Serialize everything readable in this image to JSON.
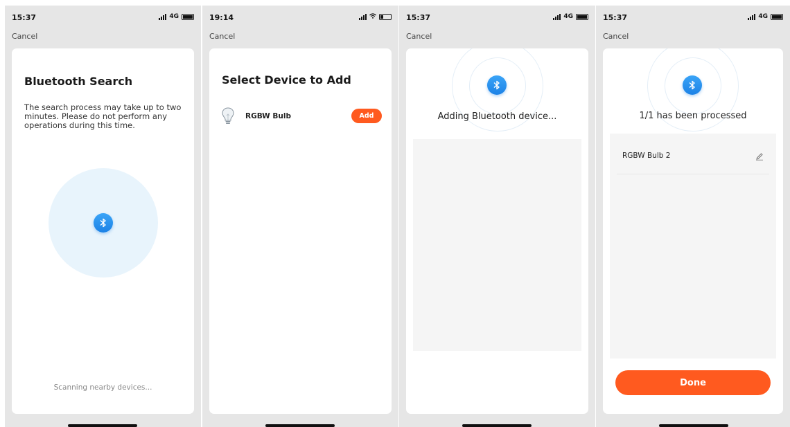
{
  "colors": {
    "accent": "#ff5a1f",
    "bluetooth": "#2a93ef",
    "panel_bg": "#e6e6e6",
    "card_bg": "#ffffff"
  },
  "screens": [
    {
      "status": {
        "time": "15:37",
        "network": "4G"
      },
      "cancel_label": "Cancel",
      "title": "Bluetooth Search",
      "description": "The search process may take up to two minutes. Please do not perform any operations during this time.",
      "scan_text": "Scanning nearby devices...",
      "icon": "bluetooth-icon"
    },
    {
      "status": {
        "time": "19:14",
        "network": "wifi"
      },
      "cancel_label": "Cancel",
      "title": "Select Device to Add",
      "device": {
        "name": "RGBW Bulb",
        "icon": "bulb-icon",
        "action_label": "Add"
      }
    },
    {
      "status": {
        "time": "15:37",
        "network": "4G"
      },
      "cancel_label": "Cancel",
      "status_text": "Adding Bluetooth device...",
      "icon": "bluetooth-icon"
    },
    {
      "status": {
        "time": "15:37",
        "network": "4G"
      },
      "cancel_label": "Cancel",
      "status_text": "1/1 has been processed",
      "result": {
        "name": "RGBW Bulb 2",
        "icon": "pencil-icon"
      },
      "done_label": "Done",
      "icon": "bluetooth-icon"
    }
  ]
}
